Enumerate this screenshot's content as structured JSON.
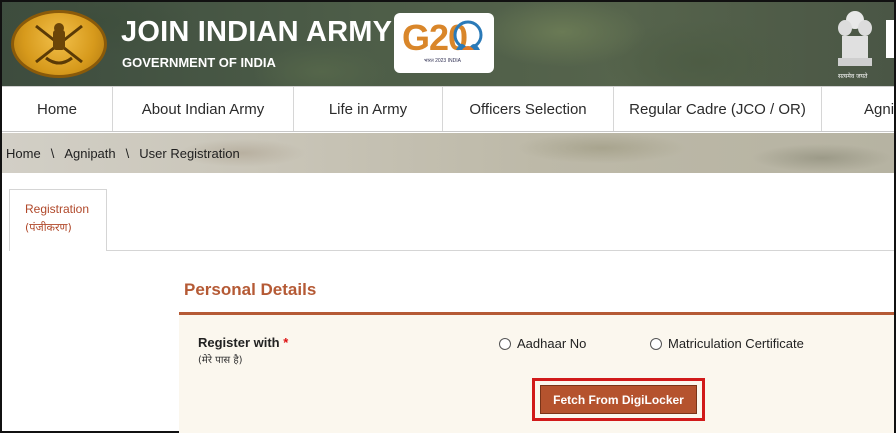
{
  "header": {
    "title": "JOIN INDIAN ARMY",
    "subtitle": "GOVERNMENT OF INDIA",
    "g20_logo_text": "G20",
    "g20_foot": "भारत 2023 INDIA",
    "emblem_left_icon": "army-crest-icon",
    "emblem_right_icon": "national-emblem-icon",
    "emblem_right_motto": "सत्यमेव जयते"
  },
  "nav": {
    "items": [
      {
        "label": "Home"
      },
      {
        "label": "About Indian Army"
      },
      {
        "label": "Life in Army"
      },
      {
        "label": "Officers Selection"
      },
      {
        "label": "Regular Cadre (JCO / OR)"
      },
      {
        "label": "Agni"
      }
    ]
  },
  "breadcrumb": {
    "items": [
      "Home",
      "Agnipath",
      "User Registration"
    ],
    "separator": "\\"
  },
  "tab": {
    "label": "Registration",
    "label_hi": "(पंजीकरण)"
  },
  "section": {
    "title": "Personal Details"
  },
  "form": {
    "register_label": "Register with",
    "required_mark": "*",
    "register_label_hi": "(मेरे पास है)",
    "options": [
      {
        "label": "Aadhaar No",
        "selected": false
      },
      {
        "label": "Matriculation Certificate",
        "selected": false
      }
    ],
    "fetch_button": "Fetch From DigiLocker"
  },
  "colors": {
    "accent": "#b55a35",
    "highlight": "#d11a1a"
  }
}
